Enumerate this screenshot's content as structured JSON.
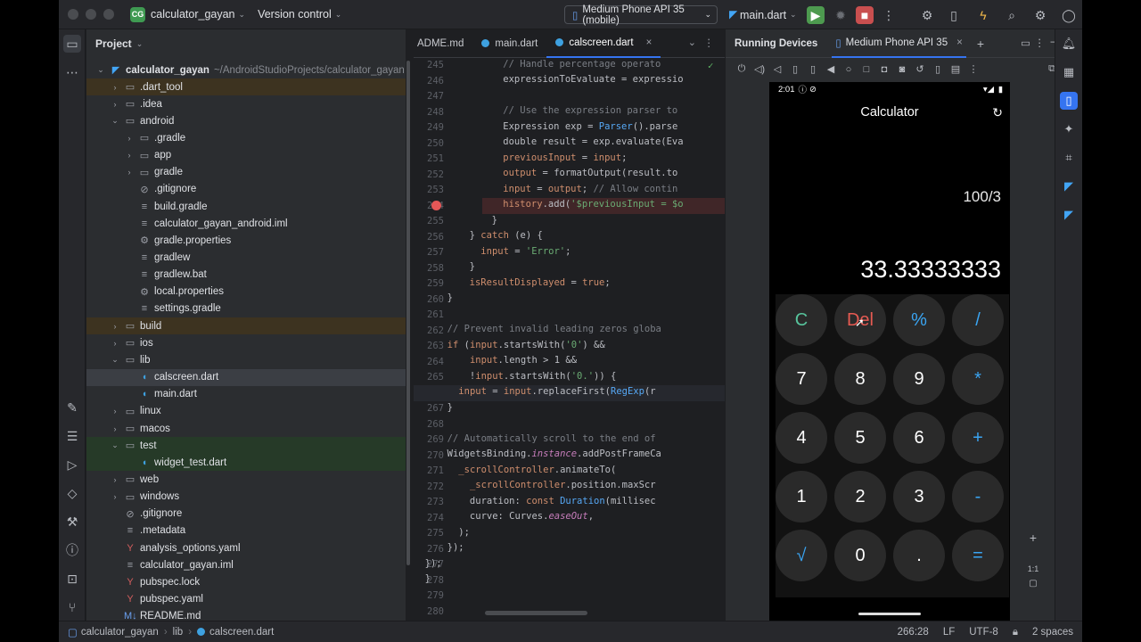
{
  "titlebar": {
    "project_badge": "CG",
    "project_name": "calculator_gayan",
    "vcs": "Version control",
    "device": "Medium Phone API 35 (mobile)",
    "run_config": "main.dart"
  },
  "project_panel": {
    "title": "Project",
    "root_name": "calculator_gayan",
    "root_path": "~/AndroidStudioProjects/calculator_gayan",
    "items": [
      {
        "label": ".dart_tool",
        "indent": 1,
        "arrow": "›",
        "icon": "folder"
      },
      {
        "label": ".idea",
        "indent": 1,
        "arrow": "›",
        "icon": "folder"
      },
      {
        "label": "android",
        "indent": 1,
        "arrow": "⌄",
        "icon": "folder"
      },
      {
        "label": ".gradle",
        "indent": 2,
        "arrow": "›",
        "icon": "folder"
      },
      {
        "label": "app",
        "indent": 2,
        "arrow": "›",
        "icon": "folder"
      },
      {
        "label": "gradle",
        "indent": 2,
        "arrow": "›",
        "icon": "folder"
      },
      {
        "label": ".gitignore",
        "indent": 2,
        "arrow": "",
        "icon": "ignore"
      },
      {
        "label": "build.gradle",
        "indent": 2,
        "arrow": "",
        "icon": "file"
      },
      {
        "label": "calculator_gayan_android.iml",
        "indent": 2,
        "arrow": "",
        "icon": "file"
      },
      {
        "label": "gradle.properties",
        "indent": 2,
        "arrow": "",
        "icon": "gear"
      },
      {
        "label": "gradlew",
        "indent": 2,
        "arrow": "",
        "icon": "file"
      },
      {
        "label": "gradlew.bat",
        "indent": 2,
        "arrow": "",
        "icon": "file"
      },
      {
        "label": "local.properties",
        "indent": 2,
        "arrow": "",
        "icon": "gear"
      },
      {
        "label": "settings.gradle",
        "indent": 2,
        "arrow": "",
        "icon": "file"
      },
      {
        "label": "build",
        "indent": 1,
        "arrow": "›",
        "icon": "folder"
      },
      {
        "label": "ios",
        "indent": 1,
        "arrow": "›",
        "icon": "folder"
      },
      {
        "label": "lib",
        "indent": 1,
        "arrow": "⌄",
        "icon": "folder"
      },
      {
        "label": "calscreen.dart",
        "indent": 2,
        "arrow": "",
        "icon": "dart"
      },
      {
        "label": "main.dart",
        "indent": 2,
        "arrow": "",
        "icon": "dart"
      },
      {
        "label": "linux",
        "indent": 1,
        "arrow": "›",
        "icon": "folder"
      },
      {
        "label": "macos",
        "indent": 1,
        "arrow": "›",
        "icon": "folder"
      },
      {
        "label": "test",
        "indent": 1,
        "arrow": "⌄",
        "icon": "folder"
      },
      {
        "label": "widget_test.dart",
        "indent": 2,
        "arrow": "",
        "icon": "dart"
      },
      {
        "label": "web",
        "indent": 1,
        "arrow": "›",
        "icon": "folder"
      },
      {
        "label": "windows",
        "indent": 1,
        "arrow": "›",
        "icon": "folder"
      },
      {
        "label": ".gitignore",
        "indent": 1,
        "arrow": "",
        "icon": "ignore"
      },
      {
        "label": ".metadata",
        "indent": 1,
        "arrow": "",
        "icon": "file"
      },
      {
        "label": "analysis_options.yaml",
        "indent": 1,
        "arrow": "",
        "icon": "yaml"
      },
      {
        "label": "calculator_gayan.iml",
        "indent": 1,
        "arrow": "",
        "icon": "file"
      },
      {
        "label": "pubspec.lock",
        "indent": 1,
        "arrow": "",
        "icon": "yaml"
      },
      {
        "label": "pubspec.yaml",
        "indent": 1,
        "arrow": "",
        "icon": "yaml"
      },
      {
        "label": "README.md",
        "indent": 1,
        "arrow": "",
        "icon": "md"
      }
    ]
  },
  "editor": {
    "tabs": [
      "ADME.md",
      "main.dart",
      "calscreen.dart"
    ],
    "line_numbers": [
      "245",
      "246",
      "247",
      "248",
      "249",
      "250",
      "251",
      "252",
      "253",
      "254",
      "255",
      "256",
      "257",
      "258",
      "259",
      "260",
      "261",
      "262",
      "263",
      "264",
      "265",
      "266",
      "267",
      "268",
      "269",
      "270",
      "271",
      "272",
      "273",
      "274",
      "275",
      "276",
      "277",
      "278",
      "279",
      "280"
    ]
  },
  "devices": {
    "title": "Running Devices",
    "device_tab": "Medium Phone API 35"
  },
  "phone": {
    "time": "2:01",
    "app_title": "Calculator",
    "expression": "100/3",
    "result": "33.33333333",
    "keys": [
      "C",
      "Del",
      "%",
      "/",
      "7",
      "8",
      "9",
      "*",
      "4",
      "5",
      "6",
      "+",
      "1",
      "2",
      "3",
      "-",
      "√",
      "0",
      ".",
      "="
    ]
  },
  "zoom": {
    "ratio": "1:1"
  },
  "statusbar": {
    "crumbs": [
      "calculator_gayan",
      "lib",
      "calscreen.dart"
    ],
    "position": "266:28",
    "line_sep": "LF",
    "encoding": "UTF-8",
    "indent": "2 spaces"
  },
  "colors": {
    "accent": "#3574f0",
    "run": "#4d9a4f",
    "stop": "#c94f4f",
    "op_key": "#3aa5f3",
    "del_key": "#e65a52",
    "clear_key": "#57c49c"
  }
}
